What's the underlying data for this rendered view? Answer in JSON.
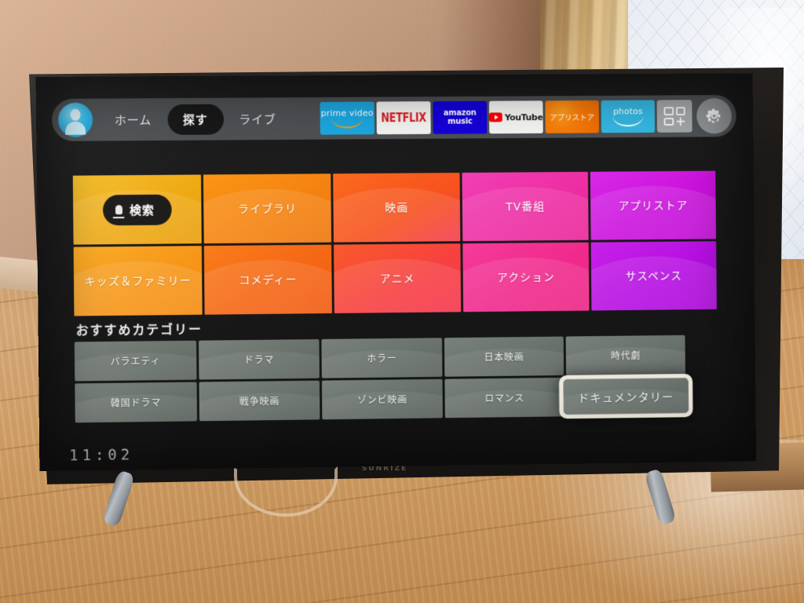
{
  "scene": {
    "device_brand": "SUNRIZE",
    "environment": "living room with beige wall, gold curtain, sheer white curtain and light wood floor"
  },
  "topbar": {
    "avatar_name": "profile-avatar",
    "tabs": [
      {
        "label": "ホーム",
        "selected": false
      },
      {
        "label": "探す",
        "selected": true
      },
      {
        "label": "ライブ",
        "selected": false
      }
    ],
    "apps": [
      {
        "id": "prime-video",
        "line1": "prime video"
      },
      {
        "id": "netflix",
        "line1": "NETFLIX"
      },
      {
        "id": "amazon-music",
        "line1": "amazon",
        "line2": "music"
      },
      {
        "id": "youtube",
        "line1": "YouTube"
      },
      {
        "id": "appstore",
        "line1": "アプリストア"
      },
      {
        "id": "photos",
        "line1": "photos"
      }
    ],
    "apps_grid_label": "apps-grid",
    "settings_label": "settings"
  },
  "tiles": [
    {
      "label": "検索",
      "type": "search",
      "color": "#f0ae14"
    },
    {
      "label": "ライブラリ",
      "type": "plain",
      "color": "#f58410"
    },
    {
      "label": "映画",
      "type": "plain",
      "color": "#f7571f"
    },
    {
      "label": "TV番組",
      "type": "plain",
      "color": "#ef30a6"
    },
    {
      "label": "アプリストア",
      "type": "plain",
      "color": "#ce18dd"
    },
    {
      "label": "キッズ＆ファミリー",
      "type": "plain",
      "color": "#f79a16"
    },
    {
      "label": "コメディー",
      "type": "plain",
      "color": "#f56a15"
    },
    {
      "label": "アニメ",
      "type": "plain",
      "color": "#f63d4e"
    },
    {
      "label": "アクション",
      "type": "plain",
      "color": "#f02a8c"
    },
    {
      "label": "サスペンス",
      "type": "plain",
      "color": "#b60fe2"
    }
  ],
  "recommend": {
    "heading": "おすすめカテゴリー",
    "categories": [
      {
        "label": "バラエティ",
        "focused": false
      },
      {
        "label": "ドラマ",
        "focused": false
      },
      {
        "label": "ホラー",
        "focused": false
      },
      {
        "label": "日本映画",
        "focused": false
      },
      {
        "label": "時代劇",
        "focused": false
      },
      {
        "label": "韓国ドラマ",
        "focused": false
      },
      {
        "label": "戦争映画",
        "focused": false
      },
      {
        "label": "ゾンビ映画",
        "focused": false
      },
      {
        "label": "ロマンス",
        "focused": false
      },
      {
        "label": "ドキュメンタリー",
        "focused": true
      }
    ]
  },
  "clock": {
    "time": "11:02"
  },
  "colors": {
    "accent_focus": "#ece7dc",
    "topbar_bg": "#565a5c",
    "selected_tab_bg": "#151515",
    "category_bg": "#6d756f"
  }
}
